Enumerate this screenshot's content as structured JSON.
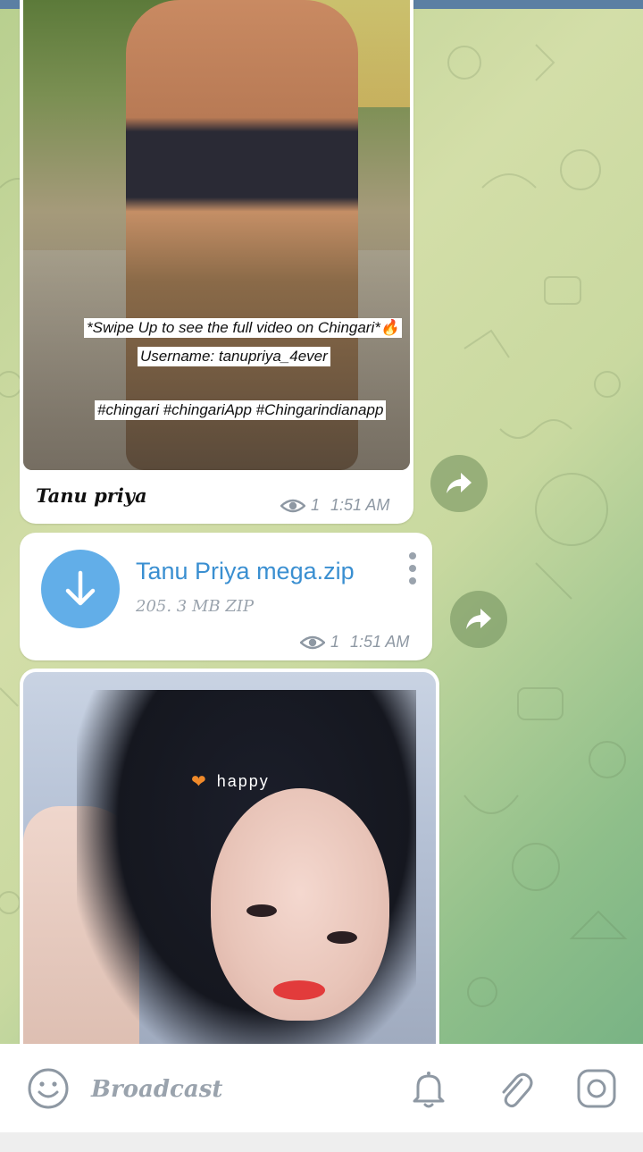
{
  "theme": {
    "accent": "#3a8fd1",
    "download_circle": "#62aee8",
    "meta_gray": "#8e98a3"
  },
  "messages": [
    {
      "type": "photo",
      "caption_overlay": [
        "*Swipe Up to see the full video on Chingari*🔥",
        "Username: tanupriya_4ever",
        "#chingari #chingariApp #Chingarindianapp"
      ],
      "author": "Tanu priya",
      "views": "1",
      "time": "1:51 AM"
    },
    {
      "type": "file",
      "file_name": "Tanu Priya mega.zip",
      "file_size": "205. 3 MB ZIP",
      "views": "1",
      "time": "1:51 AM"
    },
    {
      "type": "photo",
      "overlay_text": "happy"
    }
  ],
  "icons": {
    "view": "eye-icon",
    "forward": "forward-arrow-icon",
    "download": "download-arrow-icon",
    "menu": "kebab-menu-icon",
    "emoji": "emoji-icon",
    "bell": "bell-icon",
    "attach": "paperclip-icon",
    "camera": "instagram-icon"
  },
  "bottom_bar": {
    "placeholder": "Broadcast"
  }
}
